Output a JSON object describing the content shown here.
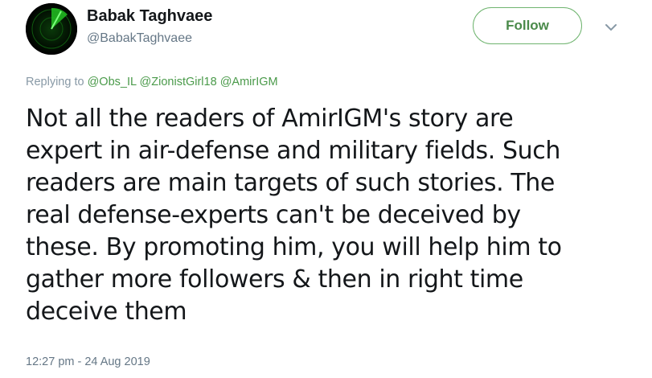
{
  "author": {
    "display_name": "Babak Taghvaee",
    "handle": "@BabakTaghvaee"
  },
  "follow_button": {
    "label": "Follow",
    "color": "#4a8a4a"
  },
  "caret_icon": "chevron-down-icon",
  "reply": {
    "prefix": "Replying to",
    "mentions": [
      "@Obs_IL",
      "@ZionistGirl18",
      "@AmirIGM"
    ]
  },
  "tweet": {
    "lines": [
      "Not all the readers of AmirIGM's story are",
      "expert in air-defense and military fields. Such",
      "readers are main targets of such stories. The",
      "real defense-experts can't be deceived by",
      "these. By promoting him, you will help him to",
      "gather more followers & then in right time",
      "deceive them"
    ]
  },
  "timestamp": "12:27 pm - 24 Aug 2019"
}
